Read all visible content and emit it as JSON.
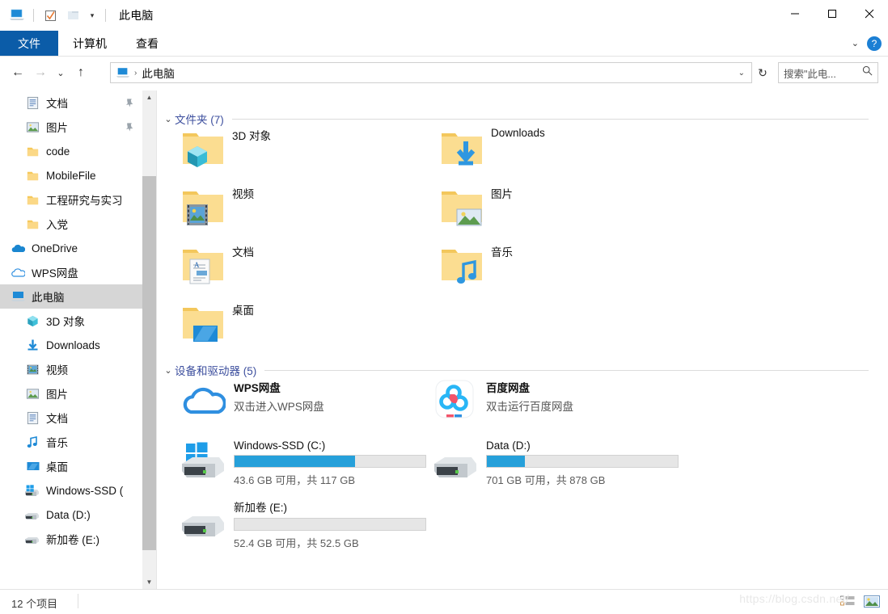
{
  "window": {
    "title": "此电脑",
    "quick_access": [
      "pc-icon",
      "checkbox-icon",
      "folder-icon",
      "dropdown-caret"
    ],
    "controls": {
      "minimize": "minimize-icon",
      "maximize": "maximize-icon",
      "close": "close-icon"
    }
  },
  "ribbon": {
    "tabs": [
      {
        "label": "文件",
        "active": true
      },
      {
        "label": "计算机",
        "active": false
      },
      {
        "label": "查看",
        "active": false
      }
    ],
    "collapse": "chevron-down-icon",
    "help": "?"
  },
  "address": {
    "back": "←",
    "forward": "→",
    "recent": "⌄",
    "up": "↑",
    "crumb_icon": "pc-icon",
    "separator": "›",
    "crumb": "此电脑",
    "dropdown": "⌄",
    "refresh": "↻"
  },
  "search": {
    "placeholder": "搜索\"此电...",
    "icon": "search-icon"
  },
  "sidebar": {
    "items": [
      {
        "label": "文档",
        "icon": "documents-icon",
        "pinned": true,
        "indent": 1,
        "selected": false
      },
      {
        "label": "图片",
        "icon": "pictures-icon",
        "pinned": true,
        "indent": 1,
        "selected": false
      },
      {
        "label": "code",
        "icon": "folder-icon",
        "pinned": false,
        "indent": 1,
        "selected": false
      },
      {
        "label": "MobileFile",
        "icon": "folder-icon",
        "pinned": false,
        "indent": 1,
        "selected": false
      },
      {
        "label": "工程研究与实习",
        "icon": "folder-icon",
        "pinned": false,
        "indent": 1,
        "selected": false
      },
      {
        "label": "入党",
        "icon": "folder-icon",
        "pinned": false,
        "indent": 1,
        "selected": false
      },
      {
        "label": "OneDrive",
        "icon": "onedrive-icon",
        "pinned": false,
        "indent": 0,
        "selected": false
      },
      {
        "label": "WPS网盘",
        "icon": "wps-cloud-icon",
        "pinned": false,
        "indent": 0,
        "selected": false
      },
      {
        "label": "此电脑",
        "icon": "pc-icon",
        "pinned": false,
        "indent": 0,
        "selected": true
      },
      {
        "label": "3D 对象",
        "icon": "3d-objects-icon",
        "pinned": false,
        "indent": 1,
        "selected": false
      },
      {
        "label": "Downloads",
        "icon": "downloads-icon",
        "pinned": false,
        "indent": 1,
        "selected": false
      },
      {
        "label": "视频",
        "icon": "videos-icon",
        "pinned": false,
        "indent": 1,
        "selected": false
      },
      {
        "label": "图片",
        "icon": "pictures-icon",
        "pinned": false,
        "indent": 1,
        "selected": false
      },
      {
        "label": "文档",
        "icon": "documents-icon",
        "pinned": false,
        "indent": 1,
        "selected": false
      },
      {
        "label": "音乐",
        "icon": "music-icon",
        "pinned": false,
        "indent": 1,
        "selected": false
      },
      {
        "label": "桌面",
        "icon": "desktop-icon",
        "pinned": false,
        "indent": 1,
        "selected": false
      },
      {
        "label": "Windows-SSD (",
        "icon": "windows-drive-icon",
        "pinned": false,
        "indent": 1,
        "selected": false
      },
      {
        "label": "Data (D:)",
        "icon": "drive-icon",
        "pinned": false,
        "indent": 1,
        "selected": false
      },
      {
        "label": "新加卷 (E:)",
        "icon": "drive-icon",
        "pinned": false,
        "indent": 1,
        "selected": false
      }
    ]
  },
  "content": {
    "folders_group": {
      "label": "文件夹 (7)",
      "chevron": "⌄"
    },
    "folders": [
      {
        "name": "3D 对象",
        "icon": "folder-3d-objects-icon"
      },
      {
        "name": "Downloads",
        "icon": "folder-downloads-icon"
      },
      {
        "name": "视频",
        "icon": "folder-videos-icon"
      },
      {
        "name": "图片",
        "icon": "folder-pictures-icon"
      },
      {
        "name": "文档",
        "icon": "folder-documents-icon"
      },
      {
        "name": "音乐",
        "icon": "folder-music-icon"
      },
      {
        "name": "桌面",
        "icon": "folder-desktop-icon"
      }
    ],
    "devices_group": {
      "label": "设备和驱动器 (5)",
      "chevron": "⌄"
    },
    "clouds": [
      {
        "name": "WPS网盘",
        "sub": "双击进入WPS网盘",
        "icon": "wps-cloud-icon"
      },
      {
        "name": "百度网盘",
        "sub": "双击运行百度网盘",
        "icon": "baidu-netdisk-icon"
      }
    ],
    "drives": [
      {
        "name": "Windows-SSD (C:)",
        "sub": "43.6 GB 可用，共 117 GB",
        "used_percent": 63,
        "icon": "windows-drive-icon"
      },
      {
        "name": "Data (D:)",
        "sub": "701 GB 可用，共 878 GB",
        "used_percent": 20,
        "icon": "drive-icon"
      },
      {
        "name": "新加卷 (E:)",
        "sub": "52.4 GB 可用，共 52.5 GB",
        "used_percent": 0,
        "icon": "drive-icon"
      }
    ]
  },
  "status": {
    "item_count": "12 个项目",
    "watermark": "https://blog.csdn.net/",
    "views": [
      {
        "name": "details-view-button",
        "label": "details"
      },
      {
        "name": "large-icons-view-button",
        "label": "icons"
      }
    ]
  },
  "colors": {
    "accent": "#0b5ca8",
    "progress_blue": "#26a0da",
    "group_header": "#3d4f9e",
    "selection": "#d6d6d6"
  }
}
